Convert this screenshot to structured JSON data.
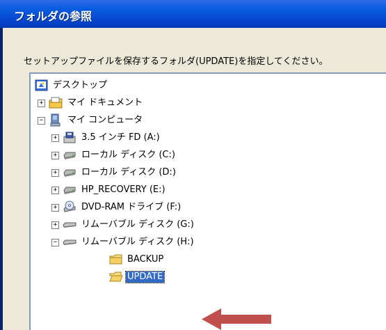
{
  "dialog": {
    "title": "フォルダの参照",
    "instruction": "セットアップファイルを保存するフォルダ(UPDATE)を指定してください。"
  },
  "tree": {
    "root": {
      "label": "デスクトップ",
      "icon": "desktop-icon"
    },
    "my_documents": {
      "label": "マイ ドキュメント",
      "icon": "my-documents-icon",
      "expander": "+"
    },
    "my_computer": {
      "label": "マイ コンピュータ",
      "icon": "my-computer-icon",
      "expander": "−"
    },
    "drives": [
      {
        "label": "3.5 インチ FD (A:)",
        "icon": "floppy-drive-icon",
        "expander": "+"
      },
      {
        "label": "ローカル ディスク (C:)",
        "icon": "hard-disk-icon",
        "expander": "+"
      },
      {
        "label": "ローカル ディスク (D:)",
        "icon": "hard-disk-icon",
        "expander": "+"
      },
      {
        "label": "HP_RECOVERY (E:)",
        "icon": "hard-disk-icon",
        "expander": "+"
      },
      {
        "label": "DVD-RAM ドライブ (F:)",
        "icon": "dvd-drive-icon",
        "expander": "+"
      },
      {
        "label": "リムーバブル ディスク (G:)",
        "icon": "removable-disk-icon",
        "expander": "+"
      },
      {
        "label": "リムーバブル ディスク (H:)",
        "icon": "removable-disk-icon",
        "expander": "−"
      }
    ],
    "folders": [
      {
        "label": "BACKUP",
        "icon": "folder-icon"
      },
      {
        "label": "UPDATE",
        "icon": "open-folder-icon",
        "selected": true
      }
    ]
  },
  "colors": {
    "title_bar": "#0a5de0",
    "dialog_bg": "#ece9d8",
    "selection": "#316ac5",
    "pointer_arrow": "#c0504d"
  }
}
